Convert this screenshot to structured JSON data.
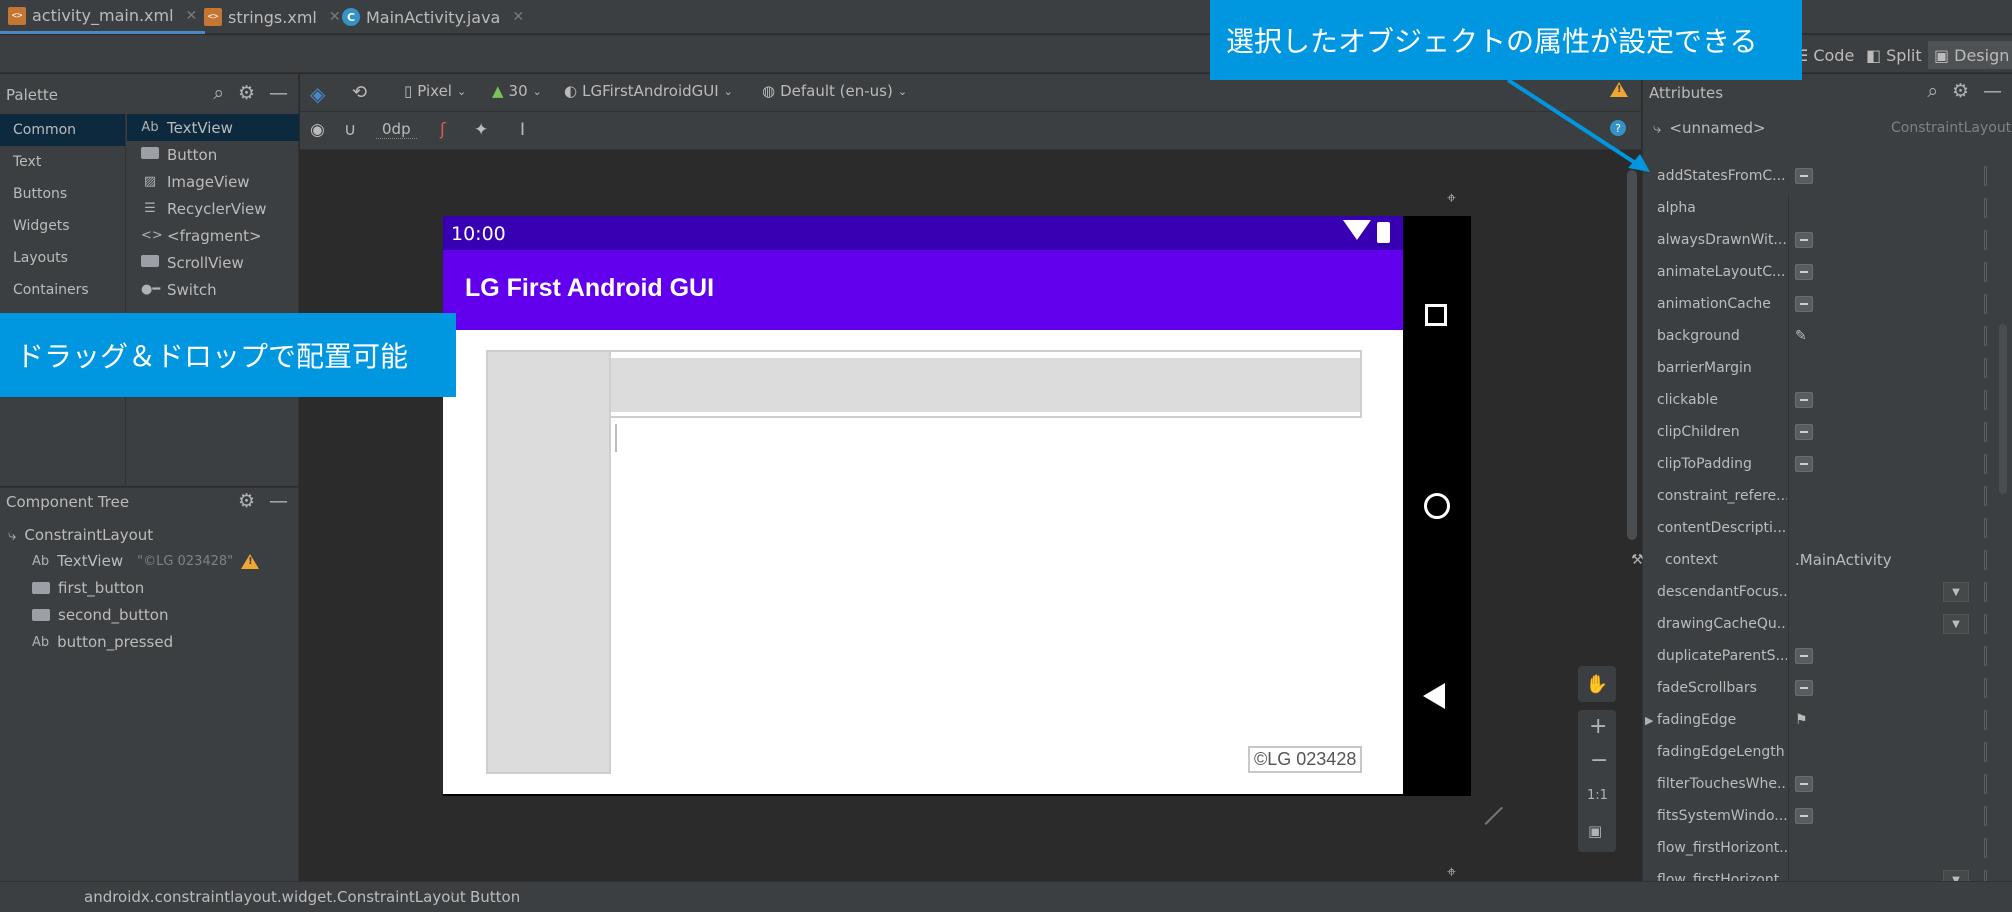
{
  "tabs": [
    {
      "label": "activity_main.xml",
      "icon": "xml-file-icon",
      "active": true
    },
    {
      "label": "strings.xml",
      "icon": "xml-file-icon",
      "active": false
    },
    {
      "label": "MainActivity.java",
      "icon": "java-class-icon",
      "active": false
    }
  ],
  "modes": {
    "code": "Code",
    "split": "Split",
    "design": "Design"
  },
  "palette": {
    "title": "Palette",
    "categories": [
      "Common",
      "Text",
      "Buttons",
      "Widgets",
      "Layouts",
      "Containers"
    ],
    "items": [
      "TextView",
      "Button",
      "ImageView",
      "RecyclerView",
      "<fragment>",
      "ScrollView",
      "Switch"
    ]
  },
  "component_tree": {
    "title": "Component Tree",
    "root": "ConstraintLayout",
    "children": [
      {
        "label": "TextView",
        "hint": "\"©LG 023428\"",
        "icon": "textview-icon",
        "warning": true
      },
      {
        "label": "first_button",
        "icon": "button-icon"
      },
      {
        "label": "second_button",
        "icon": "button-icon"
      },
      {
        "label": "button_pressed",
        "icon": "textview-icon"
      }
    ]
  },
  "design_toolbar": {
    "device": "Pixel",
    "api": "30",
    "theme": "LGFirstAndroidGUI",
    "locale": "Default (en-us)",
    "margin": "0dp"
  },
  "device": {
    "time": "10:00",
    "app_title": "LG First Android GUI",
    "copyright_text": "©LG 023428",
    "status_color": "#3700b3",
    "appbar_color": "#6200ee"
  },
  "attributes": {
    "title": "Attributes",
    "component": "<unnamed>",
    "component_type": "ConstraintLayout",
    "rows": [
      {
        "name": "addStatesFromC...",
        "control": "minus"
      },
      {
        "name": "alpha",
        "control": ""
      },
      {
        "name": "alwaysDrawnWit...",
        "control": "minus"
      },
      {
        "name": "animateLayoutC...",
        "control": "minus"
      },
      {
        "name": "animationCache",
        "control": "minus"
      },
      {
        "name": "background",
        "control": "picker"
      },
      {
        "name": "barrierMargin",
        "control": ""
      },
      {
        "name": "clickable",
        "control": "minus"
      },
      {
        "name": "clipChildren",
        "control": "minus"
      },
      {
        "name": "clipToPadding",
        "control": "minus"
      },
      {
        "name": "constraint_refere...",
        "control": ""
      },
      {
        "name": "contentDescripti...",
        "control": ""
      },
      {
        "name": "context",
        "control": "text",
        "value": ".MainActivity"
      },
      {
        "name": "descendantFocus...",
        "control": "dropdown"
      },
      {
        "name": "drawingCacheQu...",
        "control": "dropdown"
      },
      {
        "name": "duplicateParentS...",
        "control": "minus"
      },
      {
        "name": "fadeScrollbars",
        "control": "minus"
      },
      {
        "name": "fadingEdge",
        "control": "flag"
      },
      {
        "name": "fadingEdgeLength",
        "control": ""
      },
      {
        "name": "filterTouchesWhe...",
        "control": "minus"
      },
      {
        "name": "fitsSystemWindo...",
        "control": "minus"
      },
      {
        "name": "flow_firstHorizont...",
        "control": ""
      },
      {
        "name": "flow_firstHorizont...",
        "control": "dropdown"
      }
    ]
  },
  "breadcrumb": [
    "androidx.constraintlayout.widget.ConstraintLayout",
    "Button"
  ],
  "callouts": {
    "attributes_note": "選択したオブジェクトの属性が設定できる",
    "palette_note": "ドラッグ＆ドロップで配置可能"
  },
  "colors": {
    "accent": "#0097e0",
    "selection": "#0d293e",
    "warning": "#f0a732"
  }
}
